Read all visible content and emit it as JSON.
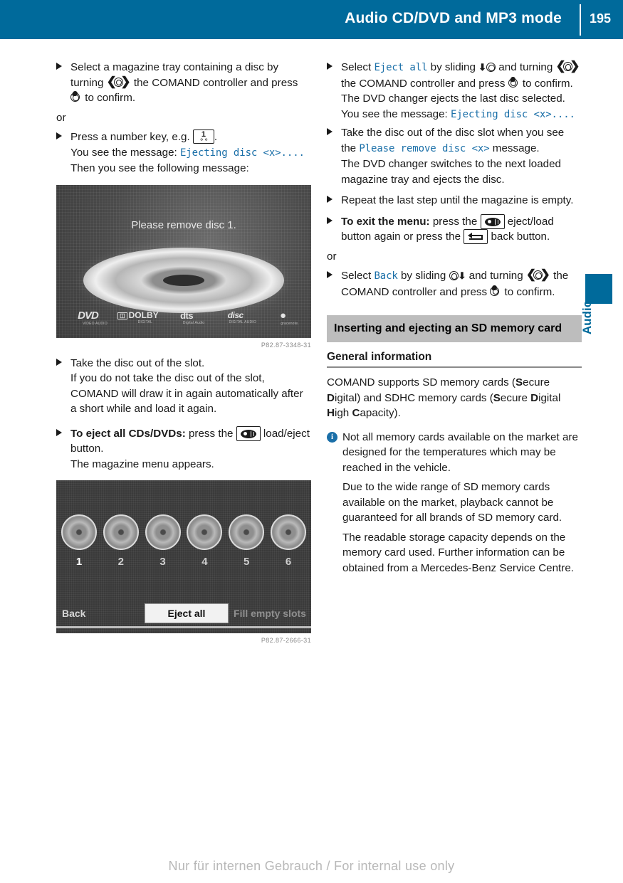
{
  "header": {
    "title": "Audio CD/DVD and MP3 mode",
    "page_number": "195",
    "bg_color": "#006a9b"
  },
  "side_tab": {
    "label": "Audio",
    "color": "#006a9b"
  },
  "left_column": {
    "step1": {
      "text_a": "Select a magazine tray containing a disc by turning ",
      "text_b": " the COMAND controller and press ",
      "text_c": " to confirm."
    },
    "or_1": "or",
    "step2": {
      "text_a": "Press a number key, e.g. ",
      "text_b": ".",
      "line2_a": "You see the message: ",
      "msg1": "Ejecting disc <x>....",
      "line2_b": " Then you see the following message:"
    },
    "figure1": {
      "screen_message": "Please remove disc 1.",
      "logos": [
        {
          "main": "DVD",
          "sub": "VIDEO AUDIO"
        },
        {
          "main": "DOLBY",
          "sub": "DIGITAL"
        },
        {
          "main": "dts",
          "sub": "Digital Audio"
        },
        {
          "main": "disc",
          "sub": "DIGITAL AUDIO"
        },
        {
          "main": "",
          "sub": "gracenote."
        }
      ],
      "caption": "P82.87-3348-31"
    },
    "step3": {
      "text": "Take the disc out of the slot.",
      "detail": "If you do not take the disc out of the slot, COMAND will draw it in again automatically after a short while and load it again."
    },
    "step4": {
      "bold": "To eject all CDs/DVDs:",
      "text_a": " press the ",
      "text_b": " load/eject button.",
      "detail": "The magazine menu appears."
    },
    "figure2": {
      "trays": [
        "1",
        "2",
        "3",
        "4",
        "5",
        "6"
      ],
      "menu_buttons": [
        "Back",
        "Eject all",
        "Fill empty slots"
      ],
      "selected_button": "Eject all",
      "caption": "P82.87-2666-31"
    }
  },
  "right_column": {
    "step1": {
      "text_a": "Select ",
      "mono": "Eject all",
      "text_b": " by sliding ",
      "text_c": " and turning ",
      "text_d": " the COMAND controller and press ",
      "text_e": " to confirm.",
      "detail_a": "The DVD changer ejects the last disc selected. You see the message: ",
      "detail_mono": "Ejecting disc <x>...."
    },
    "step2": {
      "text_a": "Take the disc out of the disc slot when you see the ",
      "mono": "Please remove disc <x>",
      "text_b": " message.",
      "detail": "The DVD changer switches to the next loaded magazine tray and ejects the disc."
    },
    "step3": {
      "text": "Repeat the last step until the magazine is empty."
    },
    "step4": {
      "bold": "To exit the menu:",
      "text_a": " press the ",
      "text_b": " eject/load button again or press the ",
      "text_c": " back button."
    },
    "or_1": "or",
    "step5": {
      "text_a": "Select ",
      "mono": "Back",
      "text_b": " by sliding ",
      "text_c": " and turning ",
      "text_d": " the COMAND controller and press ",
      "text_e": " to confirm."
    },
    "section": {
      "band_title": "Inserting and ejecting an SD memory card",
      "sub_heading": "General information",
      "para1_a": "COMAND supports SD memory cards (",
      "para1_s1": "S",
      "para1_b": "ecure ",
      "para1_s2": "D",
      "para1_c": "igital) and SDHC memory cards (",
      "para1_s3": "S",
      "para1_d": "ecure ",
      "para1_s4": "D",
      "para1_e": "igital ",
      "para1_s5": "H",
      "para1_f": "igh ",
      "para1_s6": "C",
      "para1_g": "apacity).",
      "note1": "Not all memory cards available on the market are designed for the temperatures which may be reached in the vehicle.",
      "note2": "Due to the wide range of SD memory cards available on the market, playback cannot be guaranteed for all brands of SD memory card.",
      "note3": "The readable storage capacity depends on the memory card used. Further information can be obtained from a Mercedes-Benz Service Centre."
    }
  },
  "footer": {
    "watermark": "Nur für internen Gebrauch / For internal use only"
  }
}
